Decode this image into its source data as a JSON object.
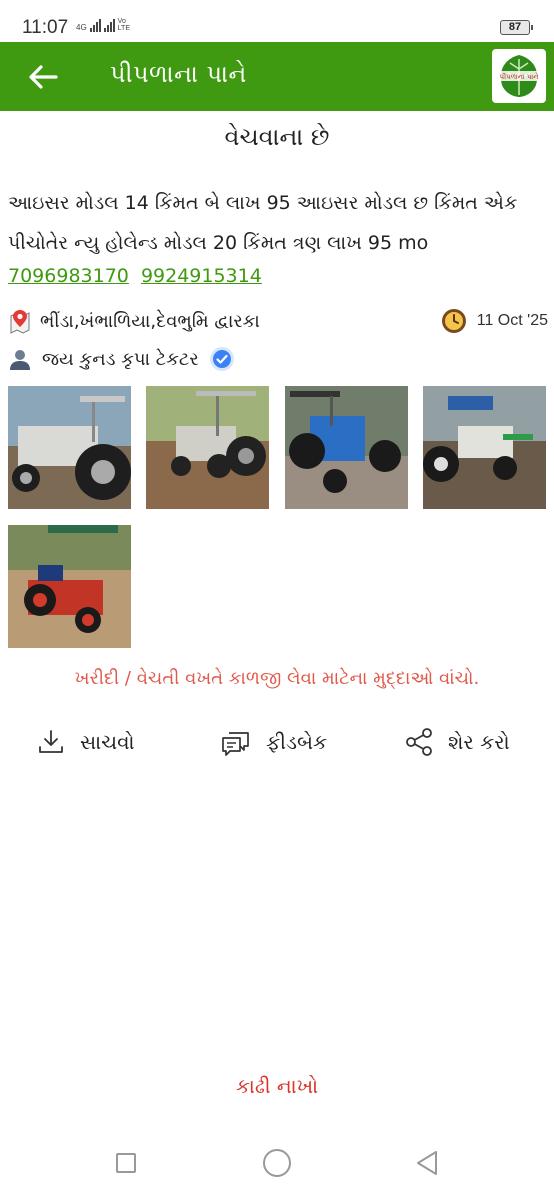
{
  "status_bar": {
    "time": "11:07",
    "network_label": "4G",
    "volte_label": "Vo LTE",
    "battery": "87"
  },
  "app_bar": {
    "title": "પીપળાના પાને",
    "logo_text": "પીપળાના પાને"
  },
  "listing": {
    "heading": "વેચવાના છે",
    "description": "આઇસર મોડલ 14 કિંમત બે લાખ 95 આઇસર મોડલ છ કિંમત એક પીચોતેર ન્યુ હોલેન્ડ મોડલ 20 કિંમત ત્રણ લાખ 95 mo",
    "phones": [
      "7096983170",
      "9924915314"
    ],
    "location": "ભીંડા,ખંભાળિયા,દેવભુમિ દ્વારકા",
    "date": "11 Oct '25",
    "seller": "જય કુનડ કૃપા ટેકટર"
  },
  "colors": {
    "brand_green": "#3f9a12",
    "advice_red": "#e05a4c",
    "remove_red": "#d9352a",
    "verified_blue": "#3b82f6"
  },
  "advice_text": "ખરીદી / વેચતી વખતે કાળજી લેવા માટેના મુદ્દાઓ વાંચો.",
  "actions": [
    {
      "label": "સાચવો",
      "icon": "download-icon"
    },
    {
      "label": "ફીડબેક",
      "icon": "feedback-icon"
    },
    {
      "label": "શેર કરો",
      "icon": "share-icon"
    }
  ],
  "remove_label": "કાઢી નાખો"
}
